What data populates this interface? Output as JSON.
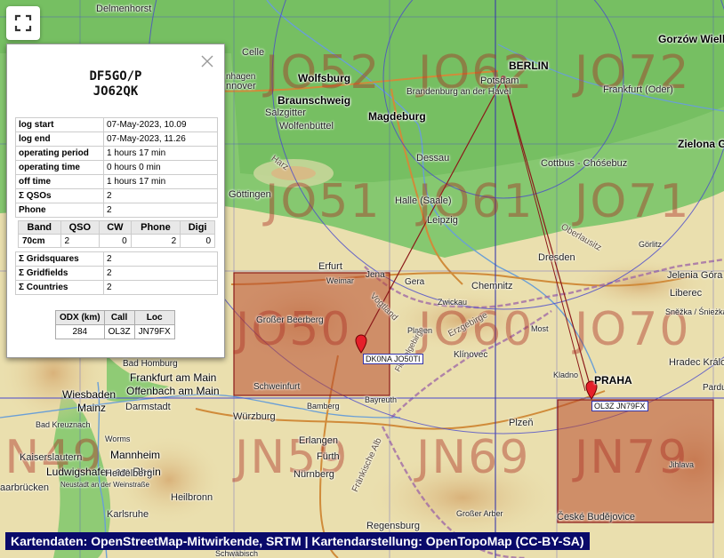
{
  "map": {
    "grid_squares": [
      {
        "label": "JO52"
      },
      {
        "label": "JO62"
      },
      {
        "label": "JO72"
      },
      {
        "label": "JO51"
      },
      {
        "label": "JO61"
      },
      {
        "label": "JO71"
      },
      {
        "label": "JO50"
      },
      {
        "label": "JO60"
      },
      {
        "label": "JO70"
      },
      {
        "label": "JN49"
      },
      {
        "label": "JN59"
      },
      {
        "label": "JN69"
      },
      {
        "label": "JN79"
      }
    ],
    "cities": [
      "Delmenhorst",
      "Celle",
      "Wolfsburg",
      "Braunschweig",
      "Salzgitter",
      "Wolfenbüttel",
      "Magdeburg",
      "BERLIN",
      "Potsdam",
      "Brandenburg an der Havel",
      "Frankfurt (Oder)",
      "Gorzów Wielk",
      "Zielona Gó",
      "Cottbus - Chóśebuz",
      "Dessau",
      "Göttingen",
      "Halle (Saale)",
      "Leipzig",
      "Dresden",
      "Görlitz",
      "Erfurt",
      "Weimar",
      "Jena",
      "Gera",
      "Zwickau",
      "Chemnitz",
      "Jelenia Góra",
      "Liberec",
      "Most",
      "Plauen",
      "Großer Beerberg",
      "Schweinfurt",
      "Bad Homburg",
      "Frankfurt am Main",
      "Offenbach am Main",
      "Wiesbaden",
      "Mainz",
      "Darmstadt",
      "Bad Kreuznach",
      "Worms",
      "Kaiserslautern",
      "Mannheim",
      "Ludwigshafen am Rhein",
      "Heidelberg",
      "Neustadt an der Weinstraße",
      "aarbrücken",
      "Heilbronn",
      "Karlsruhe",
      "Würzburg",
      "Bamberg",
      "Bayreuth",
      "Erlangen",
      "Fürth",
      "Nürnberg",
      "Plzeň",
      "Kladno",
      "PRAHA",
      "Hradec Králo",
      "Pardu",
      "Jihlava",
      "České Budějovice",
      "Regensburg",
      "Schwäbisch",
      "Klínovec",
      "Sněžka / Śnieżka",
      "Großer Arber",
      "Fichtelgebirge",
      "Erzgebirge",
      "Oberlausitz",
      "Harz",
      "Vogtland",
      "Fränkische Alb",
      "nnover",
      "nhagen"
    ],
    "markers": [
      {
        "tag": "DK0NA JO50TI"
      },
      {
        "tag": "OL3Z JN79FX"
      }
    ]
  },
  "fullscreen_icon": "fullscreen-icon",
  "panel": {
    "callsign": "DF5GO/P",
    "locator": "JO62QK",
    "close_icon": "close-icon",
    "stats": [
      {
        "key": "log start",
        "value": "07-May-2023, 10.09"
      },
      {
        "key": "log end",
        "value": "07-May-2023, 11.26"
      },
      {
        "key": "operating period",
        "value": "1 hours 17 min"
      },
      {
        "key": "operating time",
        "value": "0 hours 0 min"
      },
      {
        "key": "off time",
        "value": "1 hours 17 min"
      },
      {
        "key": "Σ QSOs",
        "value": "2"
      },
      {
        "key": "Phone",
        "value": "2"
      }
    ],
    "band_table": {
      "headers": [
        "Band",
        "QSO",
        "CW",
        "Phone",
        "Digi"
      ],
      "rows": [
        [
          "70cm",
          "2",
          "0",
          "2",
          "0"
        ]
      ]
    },
    "totals": [
      {
        "key": "Σ Gridsquares",
        "value": "2"
      },
      {
        "key": "Σ Gridfields",
        "value": "2"
      },
      {
        "key": "Σ Countries",
        "value": "2"
      }
    ],
    "odx": {
      "headers": [
        "ODX (km)",
        "Call",
        "Loc"
      ],
      "row": [
        "284",
        "OL3Z",
        "JN79FX"
      ]
    }
  },
  "attribution": "Kartendaten: OpenStreetMap-Mitwirkende, SRTM | Kartendarstellung: OpenTopoMap (CC-BY-SA)",
  "colors": {
    "square_fill": "#b84a30",
    "grid_line": "#4a4acc",
    "path_line": "#8b1a1a",
    "lowland": "#7fc46a",
    "upland": "#e7d9a4",
    "attribution_bg": "#0a0a6a"
  }
}
